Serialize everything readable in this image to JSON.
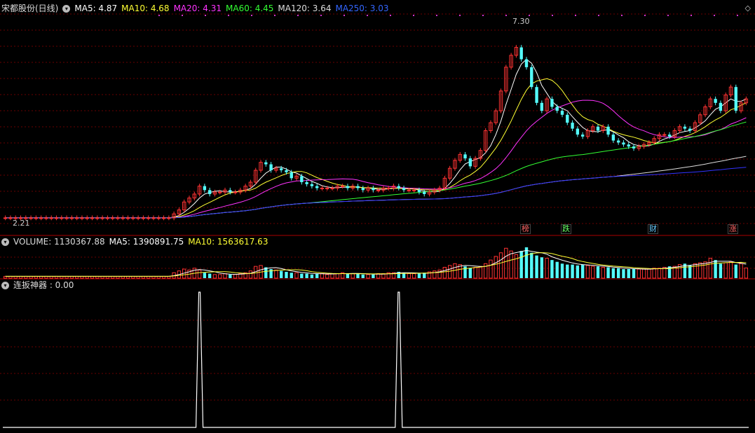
{
  "main": {
    "title": "宋都股份(日线)",
    "ma": [
      {
        "label": "MA5: 4.87",
        "color": "#ffffff"
      },
      {
        "label": "MA10: 4.68",
        "color": "#ffff33"
      },
      {
        "label": "MA20: 4.31",
        "color": "#ff33ff"
      },
      {
        "label": "MA60: 4.45",
        "color": "#33ff33"
      },
      {
        "label": "MA120: 3.64",
        "color": "#dddddd"
      },
      {
        "label": "MA250: 3.03",
        "color": "#3333ff"
      }
    ],
    "high_label": "7.30",
    "low_label": "2.21",
    "tags": [
      {
        "text": "榜",
        "color": "#ff6666"
      },
      {
        "text": "跌",
        "color": "#66ff66"
      },
      {
        "text": "财",
        "color": "#66ccff"
      },
      {
        "text": "涨",
        "color": "#ff6666"
      }
    ]
  },
  "volume": {
    "label": "VOLUME: 1130367.88",
    "ma5": "MA5: 1390891.75",
    "ma10": "MA10: 1563617.63"
  },
  "indicator": {
    "label": "连扳神器 : 0.00"
  },
  "chart_data": [
    {
      "type": "candlestick",
      "title": "宋都股份(日线)",
      "ylim": [
        2.21,
        7.3
      ],
      "close": [
        2.3,
        2.3,
        2.3,
        2.3,
        2.3,
        2.3,
        2.3,
        2.3,
        2.3,
        2.3,
        2.3,
        2.3,
        2.3,
        2.3,
        2.3,
        2.3,
        2.3,
        2.3,
        2.3,
        2.3,
        2.3,
        2.3,
        2.3,
        2.3,
        2.3,
        2.3,
        2.3,
        2.3,
        2.3,
        2.3,
        2.3,
        2.3,
        2.3,
        2.4,
        2.5,
        2.7,
        2.8,
        2.9,
        3.1,
        3.0,
        2.9,
        2.95,
        2.95,
        3.0,
        2.95,
        2.95,
        3.0,
        3.1,
        3.2,
        3.5,
        3.7,
        3.65,
        3.5,
        3.55,
        3.5,
        3.45,
        3.3,
        3.35,
        3.2,
        3.15,
        3.1,
        3.05,
        3.05,
        3.05,
        3.05,
        3.1,
        3.1,
        3.05,
        3.1,
        3.05,
        3.0,
        3.05,
        3.0,
        3.0,
        3.05,
        3.05,
        3.1,
        3.05,
        3.0,
        3.0,
        3.0,
        2.95,
        2.9,
        2.95,
        3.0,
        3.05,
        3.3,
        3.55,
        3.75,
        3.9,
        3.8,
        3.6,
        3.8,
        4.0,
        4.5,
        4.7,
        5.0,
        5.5,
        6.1,
        6.4,
        6.6,
        6.3,
        6.1,
        5.6,
        5.2,
        5.0,
        5.3,
        5.1,
        5.0,
        4.9,
        4.7,
        4.55,
        4.4,
        4.35,
        4.5,
        4.6,
        4.5,
        4.6,
        4.4,
        4.25,
        4.2,
        4.15,
        4.1,
        4.05,
        4.1,
        4.15,
        4.2,
        4.3,
        4.4,
        4.4,
        4.35,
        4.5,
        4.6,
        4.55,
        4.5,
        4.7,
        4.9,
        5.1,
        5.3,
        5.2,
        5.0,
        5.4,
        5.6,
        5.0,
        5.2,
        5.3
      ],
      "ma": [
        {
          "name": "MA5",
          "value": 4.87
        },
        {
          "name": "MA10",
          "value": 4.68
        },
        {
          "name": "MA20",
          "value": 4.31
        },
        {
          "name": "MA60",
          "value": 4.45
        },
        {
          "name": "MA120",
          "value": 3.64
        },
        {
          "name": "MA250",
          "value": 3.03
        }
      ]
    },
    {
      "type": "bar",
      "title": "VOLUME",
      "values": [
        0.2,
        0.2,
        0.2,
        0.2,
        0.2,
        0.2,
        0.2,
        0.2,
        0.2,
        0.2,
        0.2,
        0.2,
        0.2,
        0.2,
        0.2,
        0.2,
        0.2,
        0.2,
        0.2,
        0.2,
        0.2,
        0.2,
        0.2,
        0.2,
        0.2,
        0.2,
        0.2,
        0.2,
        0.2,
        0.2,
        0.2,
        0.2,
        0.2,
        0.6,
        0.8,
        1.0,
        0.9,
        1.1,
        0.9,
        0.6,
        0.5,
        0.4,
        0.4,
        0.5,
        0.4,
        0.4,
        0.5,
        0.6,
        0.8,
        1.3,
        1.4,
        1.2,
        1.0,
        0.9,
        0.8,
        0.7,
        0.6,
        0.6,
        0.5,
        0.5,
        0.4,
        0.5,
        0.5,
        0.4,
        0.5,
        0.5,
        0.6,
        0.5,
        0.5,
        0.5,
        0.4,
        0.4,
        0.4,
        0.5,
        0.5,
        0.6,
        0.6,
        0.7,
        0.6,
        0.5,
        0.5,
        0.5,
        0.6,
        0.7,
        0.8,
        0.9,
        1.2,
        1.4,
        1.6,
        1.5,
        1.3,
        1.1,
        1.2,
        1.3,
        1.6,
        2.0,
        2.4,
        2.8,
        3.3,
        3.0,
        2.6,
        3.0,
        3.4,
        2.8,
        2.5,
        2.3,
        2.2,
        2.0,
        1.8,
        1.6,
        1.5,
        1.5,
        1.4,
        1.5,
        1.4,
        1.3,
        1.3,
        1.2,
        1.2,
        1.1,
        1.1,
        1.0,
        1.0,
        1.0,
        1.0,
        1.0,
        1.0,
        1.1,
        1.1,
        1.2,
        1.3,
        1.3,
        1.5,
        1.6,
        1.4,
        1.6,
        1.7,
        1.8,
        2.2,
        2.0,
        1.6,
        1.7,
        1.8,
        1.5,
        1.6,
        1.13
      ],
      "series": [
        {
          "name": "MA5",
          "value": 1390891.75
        },
        {
          "name": "MA10",
          "value": 1563617.63
        }
      ]
    },
    {
      "type": "line",
      "title": "连扳神器",
      "values_note": "",
      "spikes_at": [
        38,
        77
      ],
      "last_value": 0.0
    }
  ]
}
